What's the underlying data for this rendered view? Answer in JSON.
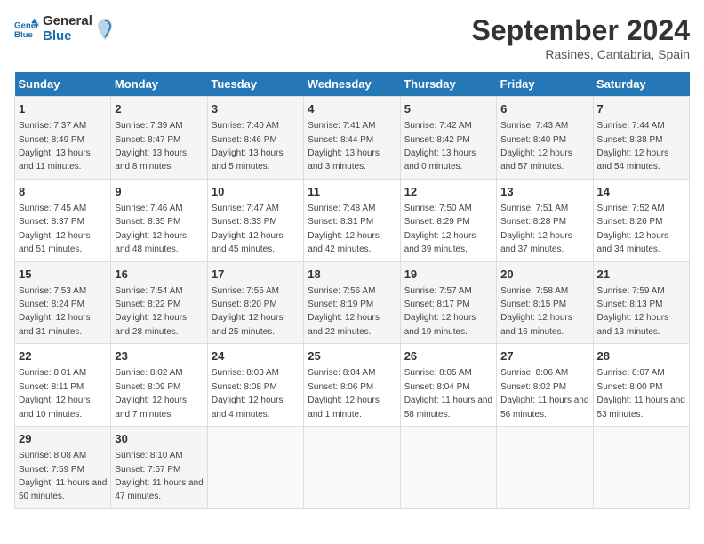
{
  "header": {
    "logo_general": "General",
    "logo_blue": "Blue",
    "month": "September 2024",
    "location": "Rasines, Cantabria, Spain"
  },
  "weekdays": [
    "Sunday",
    "Monday",
    "Tuesday",
    "Wednesday",
    "Thursday",
    "Friday",
    "Saturday"
  ],
  "weeks": [
    [
      {
        "day": 1,
        "sunrise": "7:37 AM",
        "sunset": "8:49 PM",
        "daylight": "13 hours and 11 minutes."
      },
      {
        "day": 2,
        "sunrise": "7:39 AM",
        "sunset": "8:47 PM",
        "daylight": "13 hours and 8 minutes."
      },
      {
        "day": 3,
        "sunrise": "7:40 AM",
        "sunset": "8:46 PM",
        "daylight": "13 hours and 5 minutes."
      },
      {
        "day": 4,
        "sunrise": "7:41 AM",
        "sunset": "8:44 PM",
        "daylight": "13 hours and 3 minutes."
      },
      {
        "day": 5,
        "sunrise": "7:42 AM",
        "sunset": "8:42 PM",
        "daylight": "13 hours and 0 minutes."
      },
      {
        "day": 6,
        "sunrise": "7:43 AM",
        "sunset": "8:40 PM",
        "daylight": "12 hours and 57 minutes."
      },
      {
        "day": 7,
        "sunrise": "7:44 AM",
        "sunset": "8:38 PM",
        "daylight": "12 hours and 54 minutes."
      }
    ],
    [
      {
        "day": 8,
        "sunrise": "7:45 AM",
        "sunset": "8:37 PM",
        "daylight": "12 hours and 51 minutes."
      },
      {
        "day": 9,
        "sunrise": "7:46 AM",
        "sunset": "8:35 PM",
        "daylight": "12 hours and 48 minutes."
      },
      {
        "day": 10,
        "sunrise": "7:47 AM",
        "sunset": "8:33 PM",
        "daylight": "12 hours and 45 minutes."
      },
      {
        "day": 11,
        "sunrise": "7:48 AM",
        "sunset": "8:31 PM",
        "daylight": "12 hours and 42 minutes."
      },
      {
        "day": 12,
        "sunrise": "7:50 AM",
        "sunset": "8:29 PM",
        "daylight": "12 hours and 39 minutes."
      },
      {
        "day": 13,
        "sunrise": "7:51 AM",
        "sunset": "8:28 PM",
        "daylight": "12 hours and 37 minutes."
      },
      {
        "day": 14,
        "sunrise": "7:52 AM",
        "sunset": "8:26 PM",
        "daylight": "12 hours and 34 minutes."
      }
    ],
    [
      {
        "day": 15,
        "sunrise": "7:53 AM",
        "sunset": "8:24 PM",
        "daylight": "12 hours and 31 minutes."
      },
      {
        "day": 16,
        "sunrise": "7:54 AM",
        "sunset": "8:22 PM",
        "daylight": "12 hours and 28 minutes."
      },
      {
        "day": 17,
        "sunrise": "7:55 AM",
        "sunset": "8:20 PM",
        "daylight": "12 hours and 25 minutes."
      },
      {
        "day": 18,
        "sunrise": "7:56 AM",
        "sunset": "8:19 PM",
        "daylight": "12 hours and 22 minutes."
      },
      {
        "day": 19,
        "sunrise": "7:57 AM",
        "sunset": "8:17 PM",
        "daylight": "12 hours and 19 minutes."
      },
      {
        "day": 20,
        "sunrise": "7:58 AM",
        "sunset": "8:15 PM",
        "daylight": "12 hours and 16 minutes."
      },
      {
        "day": 21,
        "sunrise": "7:59 AM",
        "sunset": "8:13 PM",
        "daylight": "12 hours and 13 minutes."
      }
    ],
    [
      {
        "day": 22,
        "sunrise": "8:01 AM",
        "sunset": "8:11 PM",
        "daylight": "12 hours and 10 minutes."
      },
      {
        "day": 23,
        "sunrise": "8:02 AM",
        "sunset": "8:09 PM",
        "daylight": "12 hours and 7 minutes."
      },
      {
        "day": 24,
        "sunrise": "8:03 AM",
        "sunset": "8:08 PM",
        "daylight": "12 hours and 4 minutes."
      },
      {
        "day": 25,
        "sunrise": "8:04 AM",
        "sunset": "8:06 PM",
        "daylight": "12 hours and 1 minute."
      },
      {
        "day": 26,
        "sunrise": "8:05 AM",
        "sunset": "8:04 PM",
        "daylight": "11 hours and 58 minutes."
      },
      {
        "day": 27,
        "sunrise": "8:06 AM",
        "sunset": "8:02 PM",
        "daylight": "11 hours and 56 minutes."
      },
      {
        "day": 28,
        "sunrise": "8:07 AM",
        "sunset": "8:00 PM",
        "daylight": "11 hours and 53 minutes."
      }
    ],
    [
      {
        "day": 29,
        "sunrise": "8:08 AM",
        "sunset": "7:59 PM",
        "daylight": "11 hours and 50 minutes."
      },
      {
        "day": 30,
        "sunrise": "8:10 AM",
        "sunset": "7:57 PM",
        "daylight": "11 hours and 47 minutes."
      },
      null,
      null,
      null,
      null,
      null
    ]
  ]
}
